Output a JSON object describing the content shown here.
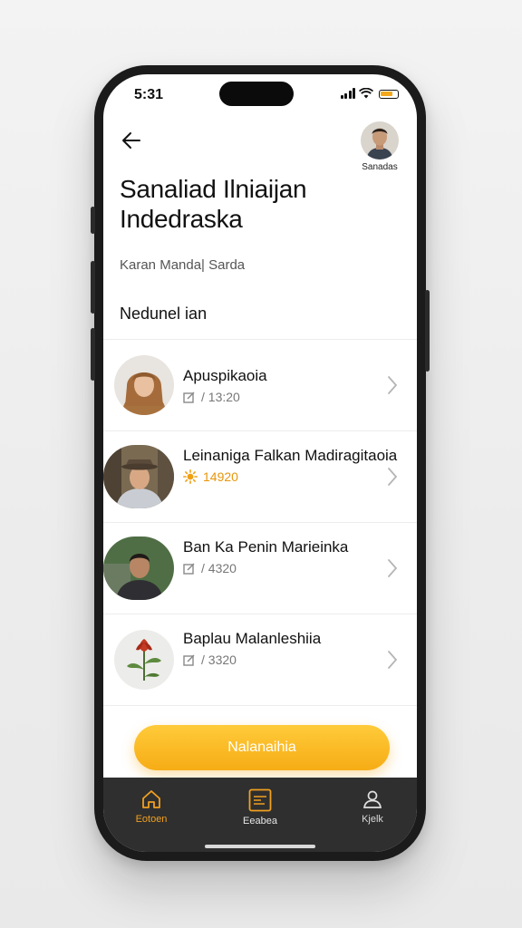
{
  "status_bar": {
    "time": "5:31"
  },
  "header": {
    "profile_name": "Sanadas",
    "title": "Sanaliad Ilniaijan Indedraska",
    "subtitle": "Karan Manda| Sarda"
  },
  "section_title": "Nedunel ian",
  "items": [
    {
      "name": "Apuspikaoia",
      "meta": "/ 13:20"
    },
    {
      "name": "Leinaniga Falkan Madiragitaoia",
      "meta": "14920"
    },
    {
      "name": "Ban Ka Penin Marieinka",
      "meta": "/ 4320"
    },
    {
      "name": "Baplau Malanleshiia",
      "meta": "/ 3320"
    }
  ],
  "cta": {
    "label": "Nalanaihia"
  },
  "tabbar": {
    "tabs": [
      {
        "label": "Eotoen"
      },
      {
        "label": "Eeabea"
      },
      {
        "label": "Kjelk"
      }
    ]
  },
  "colors": {
    "accent": "#f6ac15",
    "tabbar": "#2f2f2f",
    "active_tab": "#f0a020"
  }
}
